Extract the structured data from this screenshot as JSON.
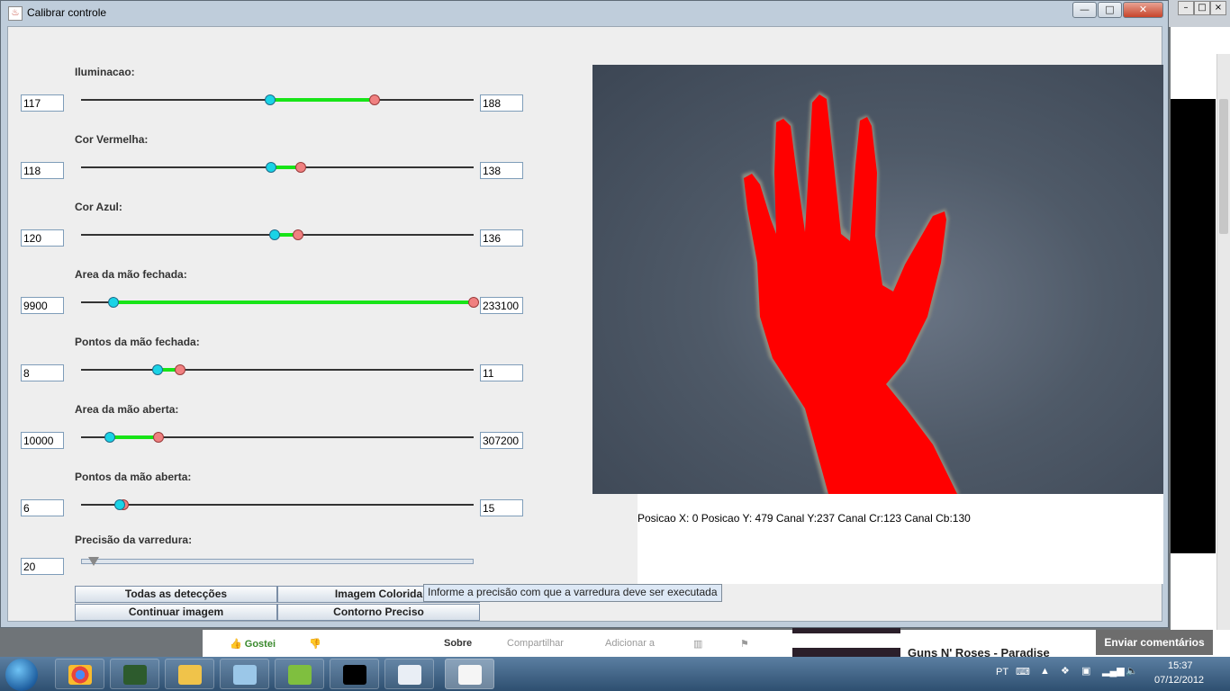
{
  "window": {
    "title": "Calibrar controle",
    "controls": {
      "minimize": "—",
      "maximize": "□",
      "close": "✕"
    }
  },
  "sliders": [
    {
      "label": "Iluminacao:",
      "min_value": "117",
      "max_value": "188",
      "low": 117,
      "high": 188,
      "range_max": 255
    },
    {
      "label": "Cor Vermelha:",
      "min_value": "118",
      "max_value": "138",
      "low": 118,
      "high": 138,
      "range_max": 255
    },
    {
      "label": "Cor Azul:",
      "min_value": "120",
      "max_value": "136",
      "low": 120,
      "high": 136,
      "range_max": 255
    },
    {
      "label": "Area da mão fechada:",
      "min_value": "9900",
      "max_value": "233100",
      "low": 9900,
      "high": 233100,
      "range_max": 233100
    },
    {
      "label": "Pontos da mão fechada:",
      "min_value": "8",
      "max_value": "11",
      "low": 8,
      "high": 11,
      "range_max": 50
    },
    {
      "label": "Area da mão aberta:",
      "min_value": "10000",
      "max_value": "307200",
      "low": 10000,
      "high": 50000,
      "range_max": 307200
    },
    {
      "label": "Pontos da mão aberta:",
      "min_value": "6",
      "max_value": "15",
      "low": 6,
      "high": 7,
      "range_max": 100
    }
  ],
  "precision": {
    "label": "Precisão da varredura:",
    "value": "20"
  },
  "buttons": {
    "all_detections": "Todas as detecções",
    "colored_image": "Imagem Colorida",
    "continue_image": "Continuar imagem",
    "precise_contour": "Contorno Preciso"
  },
  "tooltip": "Informe a precisão com que a varredura deve ser executada",
  "camera": {
    "status": "Posicao X: 0 Posicao Y: 479 Canal Y:237 Canal Cr:123 Canal Cb:130",
    "mask_color": "#ff0000"
  },
  "background_page": {
    "like": "Gostei",
    "about": "Sobre",
    "share": "Compartilhar",
    "add_to": "Adicionar a",
    "related_title": "Guns N' Roses - Paradise",
    "feedback": "Enviar comentários"
  },
  "taskbar": {
    "language": "PT",
    "time": "15:37",
    "date": "07/12/2012"
  },
  "colors": {
    "range_fill": "#17e417",
    "low_knob": "#19d3e6",
    "high_knob": "#f08080"
  }
}
